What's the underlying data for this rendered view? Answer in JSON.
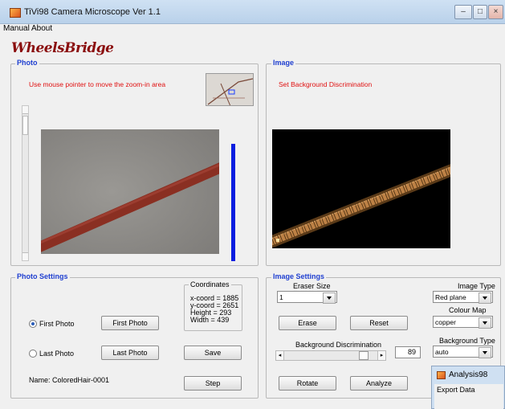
{
  "window": {
    "title": "TiVi98 Camera Microscope Ver 1.1"
  },
  "menu": {
    "items": [
      "Manual",
      "About"
    ]
  },
  "logo": {
    "text": "WheelsBridge"
  },
  "photo": {
    "legend": "Photo",
    "hint": "Use mouse pointer to move the zoom-in area"
  },
  "image": {
    "legend": "Image",
    "hint": "Set Background Discrimination"
  },
  "photo_settings": {
    "legend": "Photo Settings",
    "first_radio": "First Photo",
    "last_radio": "Last Photo",
    "first_button": "First Photo",
    "last_button": "Last Photo",
    "save_button": "Save",
    "step_button": "Step",
    "name": "Name: ColoredHair-0001",
    "coords": {
      "title": "Coordinates",
      "x": "x-coord = 1885",
      "y": "y-coord = 2651",
      "h": "Height = 293",
      "w": "Width = 439"
    }
  },
  "image_settings": {
    "legend": "Image Settings",
    "eraser_label": "Eraser Size",
    "eraser_value": "1",
    "erase_button": "Erase",
    "reset_button": "Reset",
    "bg_label": "Background Discrimination",
    "bg_value": "89",
    "bg_level": 0.89,
    "rotate_button": "Rotate",
    "analyze_button": "Analyze",
    "image_type_label": "Image Type",
    "image_type_value": "Red plane",
    "colour_map_label": "Colour Map",
    "colour_map_value": "copper",
    "bg_type_label": "Background Type",
    "bg_type_value": "auto"
  },
  "analysis": {
    "title": "Analysis98",
    "export": "Export Data"
  }
}
